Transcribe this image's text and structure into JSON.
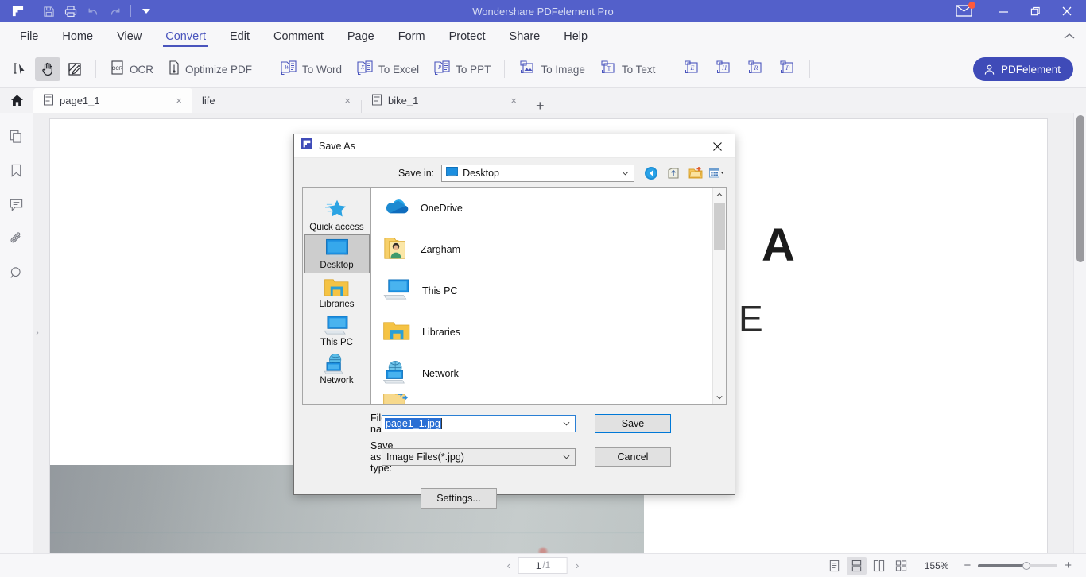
{
  "window": {
    "title": "Wondershare PDFelement Pro",
    "quick_access": [
      {
        "name": "app-logo-icon",
        "label": "PDFelement"
      },
      {
        "name": "save-icon",
        "label": "Save"
      },
      {
        "name": "print-icon",
        "label": "Print"
      },
      {
        "name": "undo-icon",
        "label": "Undo"
      },
      {
        "name": "redo-icon",
        "label": "Redo"
      },
      {
        "name": "customize-quick-access-icon",
        "label": "Customize Quick Access Toolbar"
      }
    ],
    "controls": {
      "mail": "Messages",
      "minimize": "Minimize",
      "restore": "Restore",
      "close": "Close"
    },
    "accent_color": "#5360ca"
  },
  "menubar": {
    "items": [
      {
        "label": "File",
        "active": false
      },
      {
        "label": "Home",
        "active": false
      },
      {
        "label": "View",
        "active": false
      },
      {
        "label": "Convert",
        "active": true
      },
      {
        "label": "Edit",
        "active": false
      },
      {
        "label": "Comment",
        "active": false
      },
      {
        "label": "Page",
        "active": false
      },
      {
        "label": "Form",
        "active": false
      },
      {
        "label": "Protect",
        "active": false
      },
      {
        "label": "Share",
        "active": false
      },
      {
        "label": "Help",
        "active": false
      }
    ],
    "collapse_label": "⌃"
  },
  "ribbon": {
    "tools": [
      {
        "name": "select-text-tool",
        "selected": false
      },
      {
        "name": "hand-tool",
        "selected": true
      },
      {
        "name": "edit-tool",
        "selected": false
      }
    ],
    "items": [
      {
        "label": "OCR",
        "icon": "ocr-icon"
      },
      {
        "label": "Optimize PDF",
        "icon": "optimize-pdf-icon"
      },
      {
        "label": "To Word",
        "icon": "to-word-icon"
      },
      {
        "label": "To Excel",
        "icon": "to-excel-icon"
      },
      {
        "label": "To PPT",
        "icon": "to-ppt-icon"
      },
      {
        "label": "To Image",
        "icon": "to-image-icon"
      },
      {
        "label": "To Text",
        "icon": "to-text-icon"
      }
    ],
    "icon_only": [
      {
        "label": "E",
        "name": "to-epub-icon"
      },
      {
        "label": "H",
        "name": "to-html-icon"
      },
      {
        "label": "R",
        "name": "to-rtf-icon"
      },
      {
        "label": "P",
        "name": "to-pdfa-icon"
      }
    ],
    "account_button": "PDFelement"
  },
  "tabs": {
    "home_icon": "home-icon",
    "items": [
      {
        "label": "page1_1",
        "active": true,
        "has_icon": true
      },
      {
        "label": "life",
        "active": false,
        "has_icon": false
      },
      {
        "label": "bike_1",
        "active": false,
        "has_icon": true
      }
    ],
    "close_glyph": "×",
    "new_tab_glyph": "+"
  },
  "left_rail": {
    "items": [
      {
        "name": "thumbnails-icon",
        "label": "Page Thumbnails"
      },
      {
        "name": "bookmark-icon",
        "label": "Bookmarks"
      },
      {
        "name": "comment-icon",
        "label": "Comments"
      },
      {
        "name": "attachment-icon",
        "label": "Attachments"
      },
      {
        "name": "search-icon",
        "label": "Search"
      }
    ],
    "expand_glyph": "›"
  },
  "document": {
    "glyph_a": "A",
    "glyph_e": "E"
  },
  "statusbar": {
    "prev_glyph": "‹",
    "next_glyph": "›",
    "current_page": "1",
    "total_pages": "/1",
    "view_modes": [
      {
        "name": "single-page-view-icon",
        "active": false
      },
      {
        "name": "continuous-scroll-view-icon",
        "active": true
      },
      {
        "name": "two-page-view-icon",
        "active": false
      },
      {
        "name": "grid-view-icon",
        "active": false
      }
    ],
    "zoom_level": "155%",
    "zoom_out_glyph": "−",
    "zoom_in_glyph": "+"
  },
  "dialog": {
    "title": "Save As",
    "close_glyph": "✕",
    "save_in_label": "Save in:",
    "save_in_value": "Desktop",
    "nav_tools": [
      {
        "name": "back-icon",
        "label": "Back"
      },
      {
        "name": "up-one-level-icon",
        "label": "Up one level"
      },
      {
        "name": "new-folder-icon",
        "label": "Create New Folder"
      },
      {
        "name": "views-icon",
        "label": "Views"
      }
    ],
    "places": [
      {
        "label": "Quick access",
        "icon": "quick-access-icon",
        "selected": false
      },
      {
        "label": "Desktop",
        "icon": "desktop-icon",
        "selected": true
      },
      {
        "label": "Libraries",
        "icon": "libraries-icon",
        "selected": false
      },
      {
        "label": "This PC",
        "icon": "this-pc-icon",
        "selected": false
      },
      {
        "label": "Network",
        "icon": "network-icon",
        "selected": false
      }
    ],
    "files": [
      {
        "label": "OneDrive",
        "icon": "onedrive-icon"
      },
      {
        "label": "Zargham",
        "icon": "user-folder-icon"
      },
      {
        "label": "This PC",
        "icon": "this-pc-icon"
      },
      {
        "label": "Libraries",
        "icon": "libraries-folder-icon"
      },
      {
        "label": "Network",
        "icon": "network-icon"
      }
    ],
    "file_name_label": "File name:",
    "file_name_value": "page1_1.jpg",
    "save_as_type_label": "Save as type:",
    "save_as_type_value": "Image Files(*.jpg)",
    "save_button": "Save",
    "cancel_button": "Cancel",
    "settings_button": "Settings..."
  }
}
